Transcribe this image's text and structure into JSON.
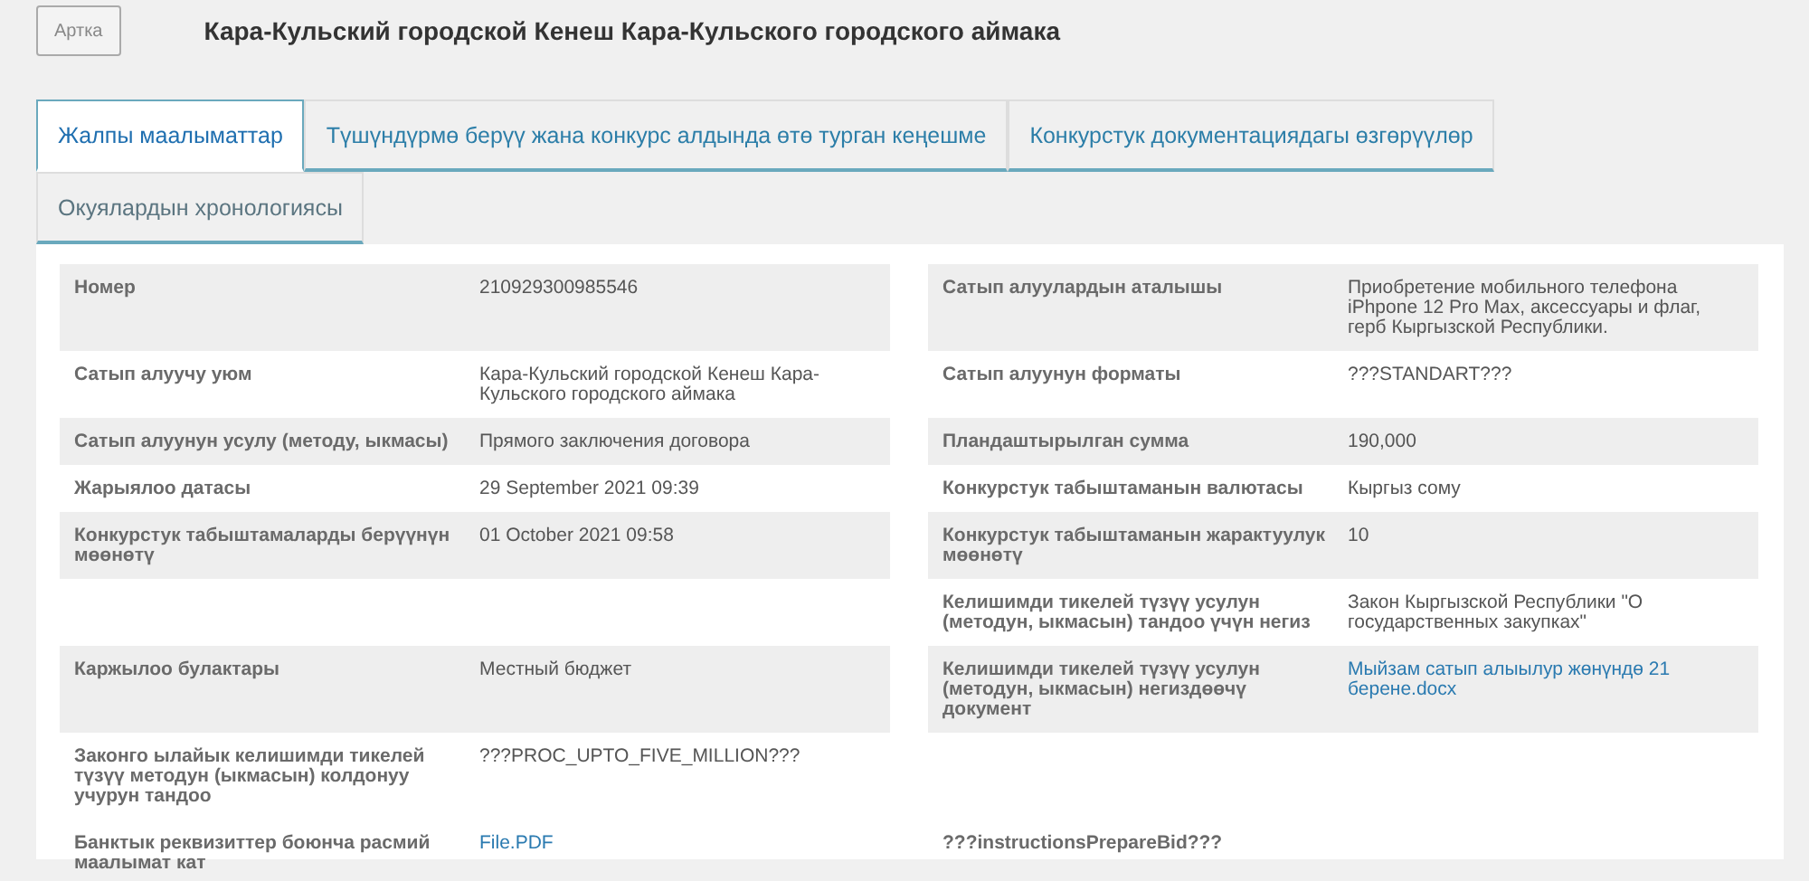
{
  "back_button": "Артка",
  "title": "Кара-Кульский городской Кенеш Кара-Кульского городского аймака",
  "tabs": [
    {
      "label": "Жалпы маалыматтар",
      "selected": true
    },
    {
      "label": "Түшүндүрмө берүү жана конкурс алдында өтө турган кеңешме",
      "selected": false
    },
    {
      "label": "Конкурстук документациядагы өзгөрүүлөр",
      "selected": false
    },
    {
      "label": "Окуялардын хронологиясы",
      "selected": false
    }
  ],
  "rows": [
    {
      "shaded": true,
      "left": {
        "label": "Номер",
        "value": "210929300985546",
        "kind": "text"
      },
      "right": {
        "label": "Сатып алуулардын аталышы",
        "value": "Приобретение мобильного телефона iPhpone 12 Pro Max, аксессуары и флаг, герб Кыргызской Республики.",
        "kind": "text"
      }
    },
    {
      "shaded": false,
      "left": {
        "label": "Сатып алуучу уюм",
        "value": "Кара-Кульский городской Кенеш Кара-Кульского городского аймака",
        "kind": "text"
      },
      "right": {
        "label": "Сатып алуунун форматы",
        "value": "???STANDART???",
        "kind": "text"
      }
    },
    {
      "shaded": true,
      "left": {
        "label": "Сатып алуунун усулу (методу, ыкмасы)",
        "value": "Прямого заключения договора",
        "kind": "text"
      },
      "right": {
        "label": "Пландаштырылган сумма",
        "value": "190,000",
        "kind": "text"
      }
    },
    {
      "shaded": false,
      "left": {
        "label": "Жарыялоо датасы",
        "value": "29 September 2021 09:39",
        "kind": "text"
      },
      "right": {
        "label": "Конкурстук табыштаманын валютасы",
        "value": "Кыргыз сому",
        "kind": "text"
      }
    },
    {
      "shaded": true,
      "left": {
        "label": "Конкурстук табыштамаларды берүүнүн мөөнөтү",
        "value": "01 October 2021 09:58",
        "kind": "text"
      },
      "right": {
        "label": "Конкурстук табыштаманын жарактуулук мөөнөтү",
        "value": "10",
        "kind": "text"
      }
    },
    {
      "shaded": false,
      "right": {
        "label": "Келишимди тикелей түзүү усулун (методун, ыкмасын) тандоо үчүн негиз",
        "value": "Закон Кыргызской Республики \"О государственных закупках\"",
        "kind": "text"
      }
    },
    {
      "shaded": true,
      "left": {
        "label": "Каржылоо булактары",
        "value": "Местный бюджет",
        "kind": "text"
      },
      "right": {
        "label": "Келишимди тикелей түзүү усулун (методун, ыкмасын) негиздөөчү документ",
        "value": "Мыйзам сатып алыылур жөнүндө 21 берене.docx",
        "kind": "link"
      }
    },
    {
      "shaded": false,
      "left": {
        "label": "Законго ылайык келишимди тикелей түзүү методун (ыкмасын) колдонуу учурун тандоо",
        "value": "???PROC_UPTO_FIVE_MILLION???",
        "kind": "text"
      }
    },
    {
      "shaded": false,
      "left": {
        "label": "Банктык реквизиттер боюнча расмий маалымат кат",
        "value": "File.PDF",
        "kind": "link"
      },
      "right": {
        "label": "???instructionsPrepareBid???"
      }
    }
  ]
}
